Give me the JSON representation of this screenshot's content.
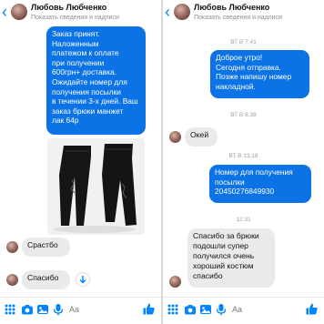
{
  "colors": {
    "accent": "#0084ff",
    "outgoing_bubble": "#0b73e6",
    "incoming_bubble": "#eaeaea"
  },
  "left": {
    "header": {
      "title": "Любовь Любченко",
      "subtitle": "Показать сведения и надписи"
    },
    "messages": {
      "order_confirm": "Заказ принят.\nНаложенным\nплатежом к оплате\nпри получении\n600грн+ доставка.\nОжидайте номер для\nполучения посылки\nв течении 3-х дней. Ваш\nзаказ брюки манжет\nлак 64р",
      "srastbo": "Срастбо",
      "spasibo": "Спасибо"
    },
    "composer": {
      "placeholder": "Aa"
    }
  },
  "right": {
    "header": {
      "title": "Любовь Любченко",
      "subtitle": "Показать сведения и надписи"
    },
    "timestamps": {
      "t1": "ВТ В 7:41",
      "t2": "ВТ В 8:38",
      "t3": "ВТ В 13:18",
      "t4": "12:31"
    },
    "messages": {
      "morning": "Доброе утро!\nСегодня отправка.\nПозже напишу номер\nнакладной.",
      "okey": "Окей",
      "tracking": "Номер для получения\nпосылки\n20450276849930",
      "thanks": "Спасибо за брюки\nподошли супер\nполучился очень\nхороший костюм\nспасибо"
    },
    "composer": {
      "placeholder": "Aa"
    }
  },
  "icons": [
    "back-arrow-icon",
    "grid-icon",
    "camera-icon",
    "image-icon",
    "microphone-icon",
    "like-thumb-icon",
    "scroll-down-icon"
  ]
}
